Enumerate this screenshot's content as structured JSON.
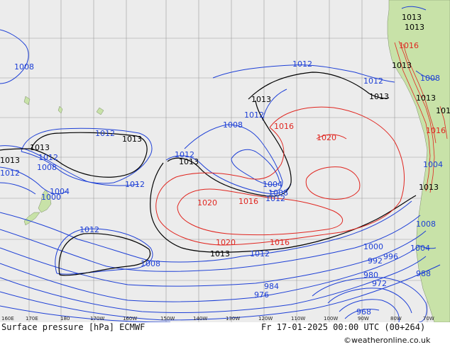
{
  "title": "Surface pressure [hPa] ECMWF",
  "valid_time": "Fr 17-01-2025 00:00 UTC (00+264)",
  "credit": "©weatheronline.co.uk",
  "colors": {
    "ocean": "#ececec",
    "land": "#c8e2a8",
    "isobar_low": "#1d3fd6",
    "isobar_reference": "#000000",
    "isobar_high": "#e0251f",
    "grid": "#9a9a9a"
  },
  "longitude_ticks": [
    "160E",
    "170E",
    "180",
    "170W",
    "160W",
    "150W",
    "140W",
    "130W",
    "120W",
    "110W",
    "100W",
    "90W",
    "80W",
    "70W"
  ],
  "isobar_labels": [
    {
      "text": "1008",
      "group": "blue"
    },
    {
      "text": "1012",
      "group": "blue"
    },
    {
      "text": "1013",
      "group": "black"
    },
    {
      "text": "1013",
      "group": "black"
    },
    {
      "text": "1012",
      "group": "blue"
    },
    {
      "text": "1013",
      "group": "black"
    },
    {
      "text": "1012",
      "group": "blue"
    },
    {
      "text": "1008",
      "group": "blue"
    },
    {
      "text": "1004",
      "group": "blue"
    },
    {
      "text": "1000",
      "group": "blue"
    },
    {
      "text": "1012",
      "group": "blue"
    },
    {
      "text": "1012",
      "group": "blue"
    },
    {
      "text": "1013",
      "group": "black"
    },
    {
      "text": "1012",
      "group": "blue"
    },
    {
      "text": "1008",
      "group": "blue"
    },
    {
      "text": "1004",
      "group": "blue"
    },
    {
      "text": "1008",
      "group": "blue"
    },
    {
      "text": "1012",
      "group": "blue"
    },
    {
      "text": "1013",
      "group": "black"
    },
    {
      "text": "1012",
      "group": "blue"
    },
    {
      "text": "1013",
      "group": "black"
    },
    {
      "text": "1012",
      "group": "blue"
    },
    {
      "text": "1013",
      "group": "black"
    },
    {
      "text": "1016",
      "group": "red"
    },
    {
      "text": "1020",
      "group": "red"
    },
    {
      "text": "1020",
      "group": "red"
    },
    {
      "text": "1016",
      "group": "red"
    },
    {
      "text": "1020",
      "group": "red"
    },
    {
      "text": "1016",
      "group": "red"
    },
    {
      "text": "1012",
      "group": "blue"
    },
    {
      "text": "1008",
      "group": "blue"
    },
    {
      "text": "1000",
      "group": "blue"
    },
    {
      "text": "996",
      "group": "blue"
    },
    {
      "text": "992",
      "group": "blue"
    },
    {
      "text": "988",
      "group": "blue"
    },
    {
      "text": "984",
      "group": "blue"
    },
    {
      "text": "980",
      "group": "blue"
    },
    {
      "text": "976",
      "group": "blue"
    },
    {
      "text": "972",
      "group": "blue"
    },
    {
      "text": "968",
      "group": "blue"
    },
    {
      "text": "1013",
      "group": "black"
    },
    {
      "text": "1013",
      "group": "black"
    },
    {
      "text": "1013",
      "group": "black"
    },
    {
      "text": "1016",
      "group": "red"
    },
    {
      "text": "1008",
      "group": "blue"
    },
    {
      "text": "1013",
      "group": "black"
    },
    {
      "text": "1016",
      "group": "red"
    },
    {
      "text": "101",
      "group": "black"
    },
    {
      "text": "1013",
      "group": "black"
    },
    {
      "text": "1008",
      "group": "blue"
    },
    {
      "text": "1004",
      "group": "blue"
    },
    {
      "text": "1012",
      "group": "blue"
    },
    {
      "text": "1004",
      "group": "blue"
    }
  ]
}
